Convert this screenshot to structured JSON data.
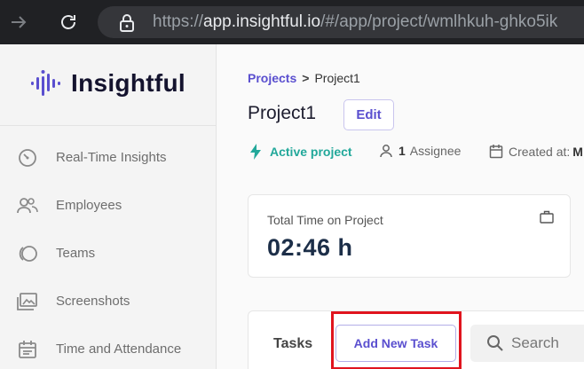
{
  "browser": {
    "url_scheme": "https://",
    "url_host": "app.insightful.io",
    "url_path": "/#/app/project/wmlhkuh-ghko5ik"
  },
  "sidebar": {
    "logo_text": "Insightful",
    "items": [
      {
        "label": "Real-Time Insights",
        "icon": "speedometer-icon"
      },
      {
        "label": "Employees",
        "icon": "people-icon"
      },
      {
        "label": "Teams",
        "icon": "teams-icon"
      },
      {
        "label": "Screenshots",
        "icon": "screenshots-icon"
      },
      {
        "label": "Time and Attendance",
        "icon": "calendar-icon"
      }
    ]
  },
  "breadcrumb": {
    "parent": "Projects",
    "separator": ">",
    "current": "Project1"
  },
  "project": {
    "title": "Project1",
    "edit_label": "Edit",
    "status": "Active project",
    "assignee_count": "1",
    "assignee_label": "Assignee",
    "created_label": "Created at:",
    "created_value": "M"
  },
  "time_card": {
    "label": "Total Time on Project",
    "value": "02:46 h"
  },
  "tasks": {
    "label": "Tasks",
    "add_button": "Add New Task",
    "search_placeholder": "Search"
  },
  "colors": {
    "accent": "#5a4fcf",
    "active_status": "#22a89a",
    "highlight": "#e0141e"
  }
}
